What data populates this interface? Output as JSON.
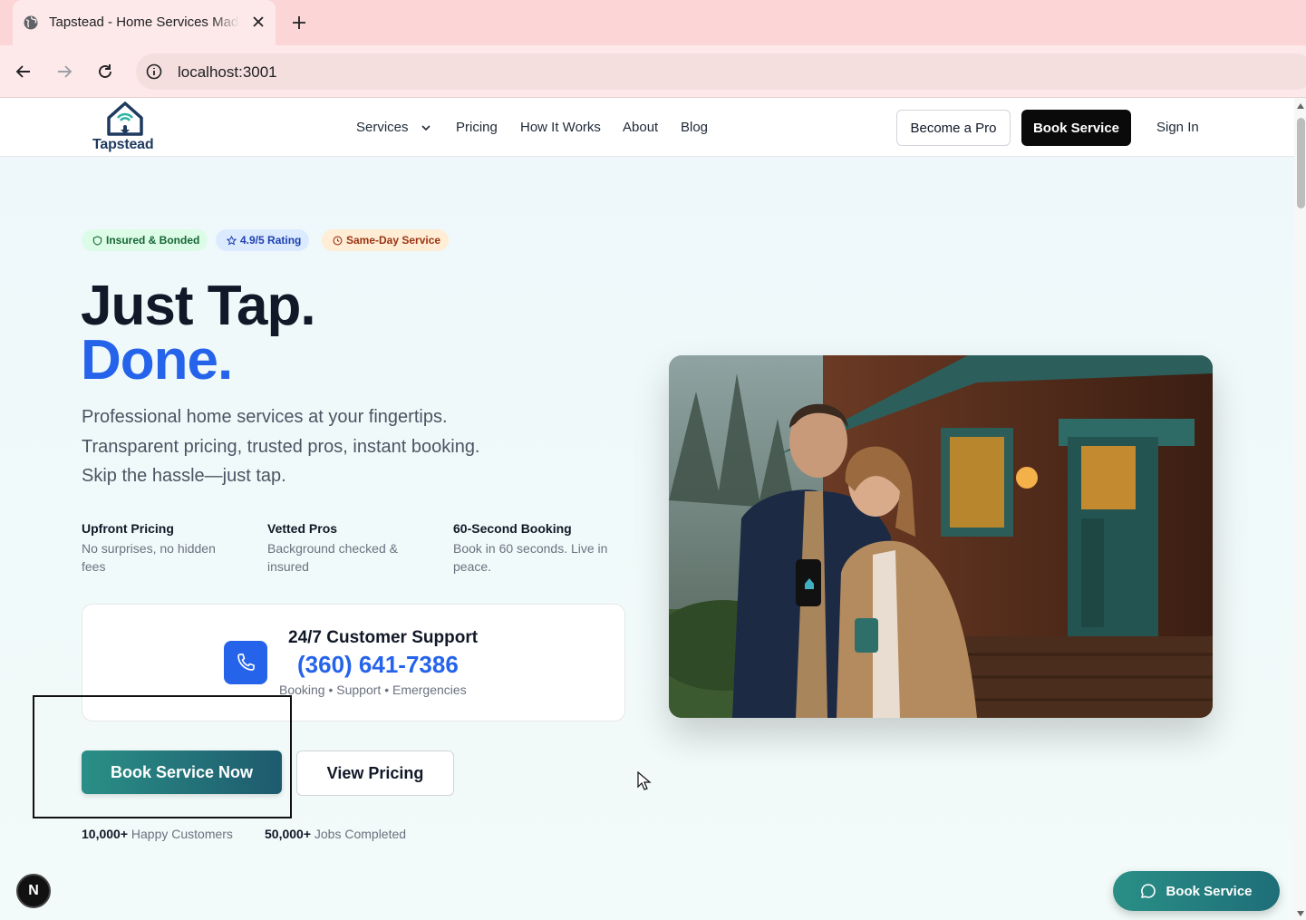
{
  "browser": {
    "tab_title": "Tapstead - Home Services Made Simple",
    "url": "localhost:3001"
  },
  "header": {
    "brand": "Tapstead",
    "nav": {
      "services": "Services",
      "pricing": "Pricing",
      "how_it_works": "How It Works",
      "about": "About",
      "blog": "Blog"
    },
    "become_pro": "Become a Pro",
    "book_service": "Book Service",
    "sign_in": "Sign In"
  },
  "hero": {
    "badges": {
      "insured": "Insured & Bonded",
      "rating": "4.9/5 Rating",
      "same_day": "Same-Day Service"
    },
    "headline_line1": "Just Tap.",
    "headline_line2": "Done.",
    "subtitle_lines": [
      "Professional home services at your fingertips.",
      "Transparent pricing, trusted pros, instant booking.",
      "Skip the hassle—just tap."
    ],
    "features": [
      {
        "title": "Upfront Pricing",
        "desc": "No surprises, no hidden fees"
      },
      {
        "title": "Vetted Pros",
        "desc": "Background checked & insured"
      },
      {
        "title": "60-Second Booking",
        "desc": "Book in 60 seconds. Live in peace."
      }
    ],
    "support": {
      "title": "24/7 Customer Support",
      "phone": "(360) 641-7386",
      "tags": "Booking • Support • Emergencies"
    },
    "cta_primary": "Book Service Now",
    "cta_secondary": "View Pricing",
    "stats": [
      {
        "value": "10,000+",
        "label": "Happy Customers"
      },
      {
        "value": "50,000+",
        "label": "Jobs Completed"
      }
    ]
  },
  "floating": {
    "dev_badge": "N",
    "book_service": "Book Service"
  },
  "colors": {
    "accent_blue": "#2563eb",
    "teal": "#2a8f86",
    "dark": "#0a0a0a"
  }
}
